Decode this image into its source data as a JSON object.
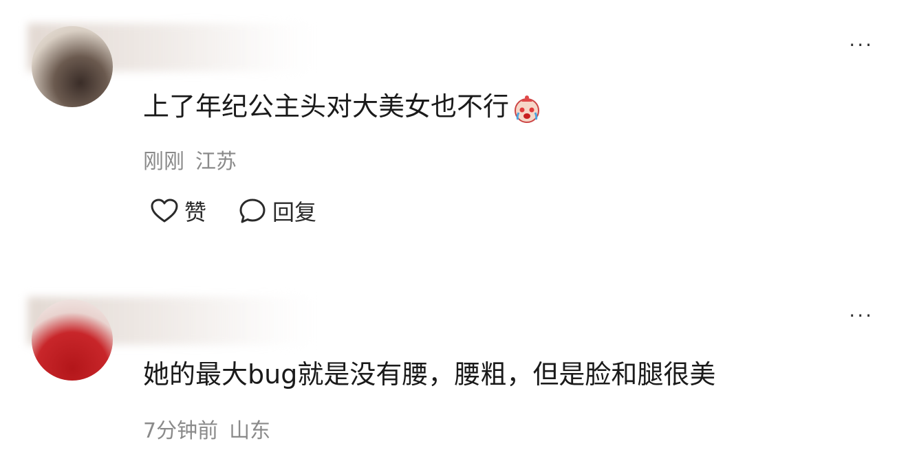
{
  "comments": [
    {
      "text": "上了年纪公主头对大美女也不行",
      "emoji": "crying-clown-emoji",
      "time": "刚刚",
      "location": "江苏",
      "more_label": "···",
      "like_label": "赞",
      "reply_label": "回复"
    },
    {
      "text": "她的最大bug就是没有腰，腰粗，但是脸和腿很美",
      "time": "7分钟前",
      "location": "山东",
      "more_label": "···"
    }
  ],
  "colors": {
    "text": "#1a1a1a",
    "meta": "#8a8a8a",
    "background": "#ffffff"
  }
}
